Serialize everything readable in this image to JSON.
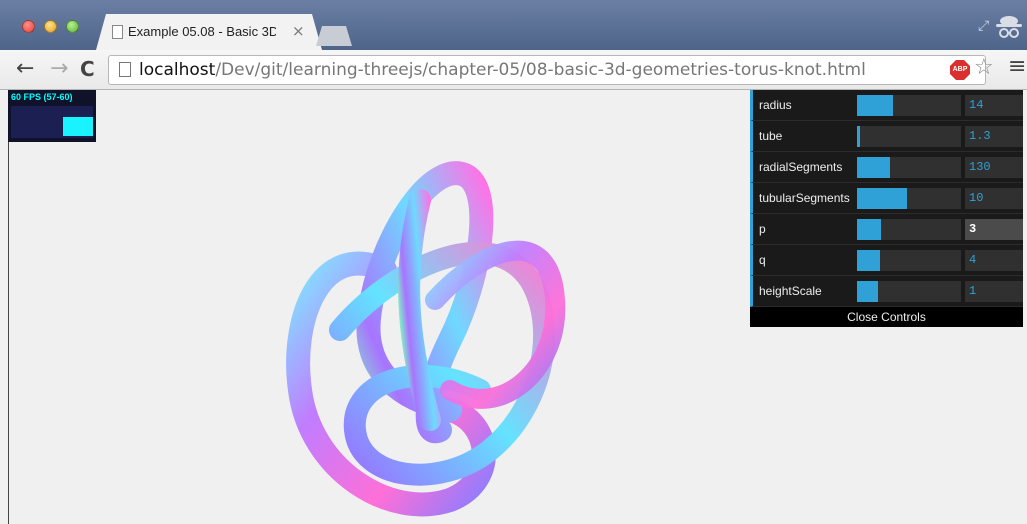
{
  "browser": {
    "tab_title": "Example 05.08 - Basic 3D",
    "tab_close": "×",
    "url_host": "localhost",
    "url_path": "/Dev/git/learning-threejs/chapter-05/08-basic-3d-geometries-torus-knot.html",
    "back_glyph": "←",
    "forward_glyph": "→",
    "reload_glyph": "C",
    "star_glyph": "☆",
    "menu_glyph": "≡",
    "adblock_label": "ABP"
  },
  "stats": {
    "label": "60 FPS (57-60)",
    "fps_level_fraction": 0.6
  },
  "controls": {
    "rows": [
      {
        "label": "radius",
        "value": "14",
        "fill": 0.35
      },
      {
        "label": "tube",
        "value": "1.3",
        "fill": 0.03
      },
      {
        "label": "radialSegments",
        "value": "130",
        "fill": 0.32
      },
      {
        "label": "tubularSegments",
        "value": "10",
        "fill": 0.48
      },
      {
        "label": "p",
        "value": "3",
        "fill": 0.23
      },
      {
        "label": "q",
        "value": "4",
        "fill": 0.22
      },
      {
        "label": "heightScale",
        "value": "1",
        "fill": 0.2
      }
    ],
    "close_label": "Close Controls"
  },
  "colors": {
    "accent": "#2fa1d6",
    "stats_bar": "#19f2ff"
  }
}
